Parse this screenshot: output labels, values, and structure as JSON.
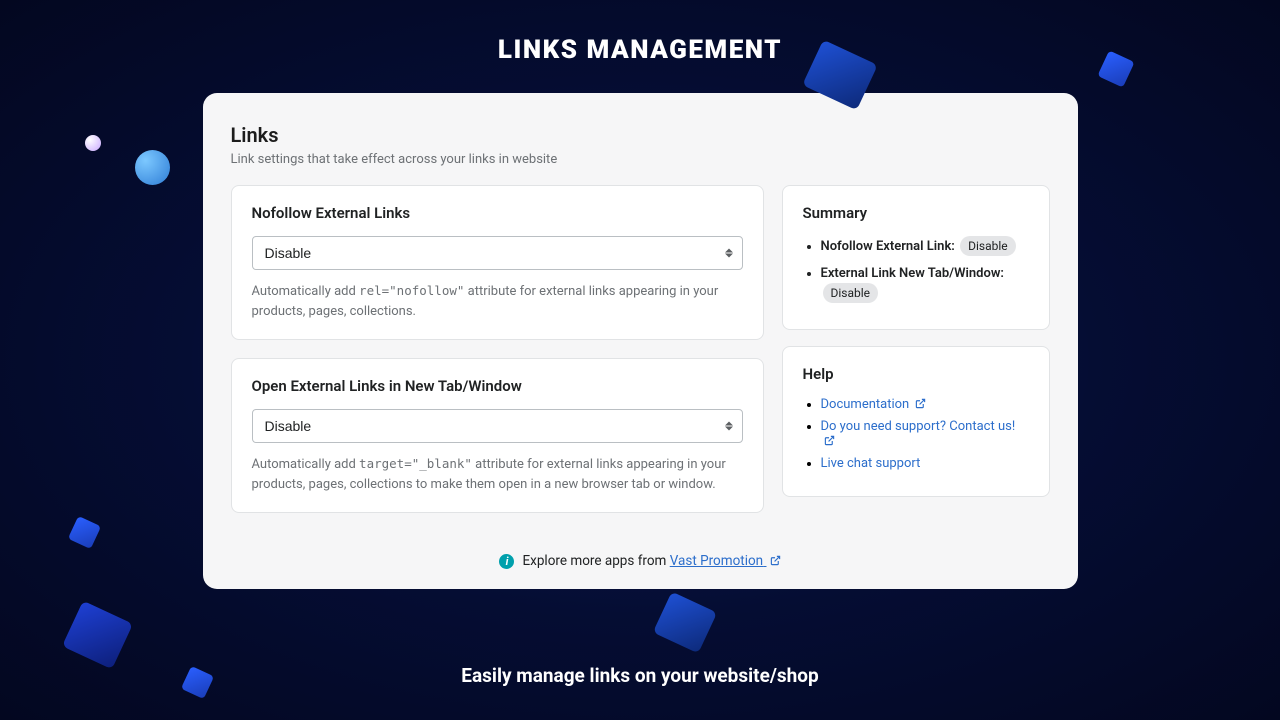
{
  "page": {
    "title": "LINKS MANAGEMENT",
    "subtitle": "Easily manage links on your website/shop"
  },
  "section": {
    "heading": "Links",
    "description": "Link settings that take effect across your links in website"
  },
  "cards": {
    "nofollow": {
      "title": "Nofollow External Links",
      "selected": "Disable",
      "description_pre": "Automatically add ",
      "description_code": "rel=\"nofollow\"",
      "description_post": " attribute for external links appearing in your products, pages, collections."
    },
    "newtab": {
      "title": "Open External Links in New Tab/Window",
      "selected": "Disable",
      "description_pre": "Automatically add ",
      "description_code": "target=\"_blank\"",
      "description_post": " attribute for external links appearing in your products, pages, collections to make them open in a new browser tab or window."
    }
  },
  "summary": {
    "title": "Summary",
    "items": [
      {
        "label": "Nofollow External Link:",
        "value": "Disable"
      },
      {
        "label": "External Link New Tab/Window:",
        "value": "Disable"
      }
    ]
  },
  "help": {
    "title": "Help",
    "links": [
      {
        "label": "Documentation",
        "external": true
      },
      {
        "label": "Do you need support? Contact us!",
        "external": true
      },
      {
        "label": "Live chat support",
        "external": false
      }
    ]
  },
  "footer": {
    "text_pre": "Explore more apps from ",
    "link_label": "Vast Promotion"
  }
}
